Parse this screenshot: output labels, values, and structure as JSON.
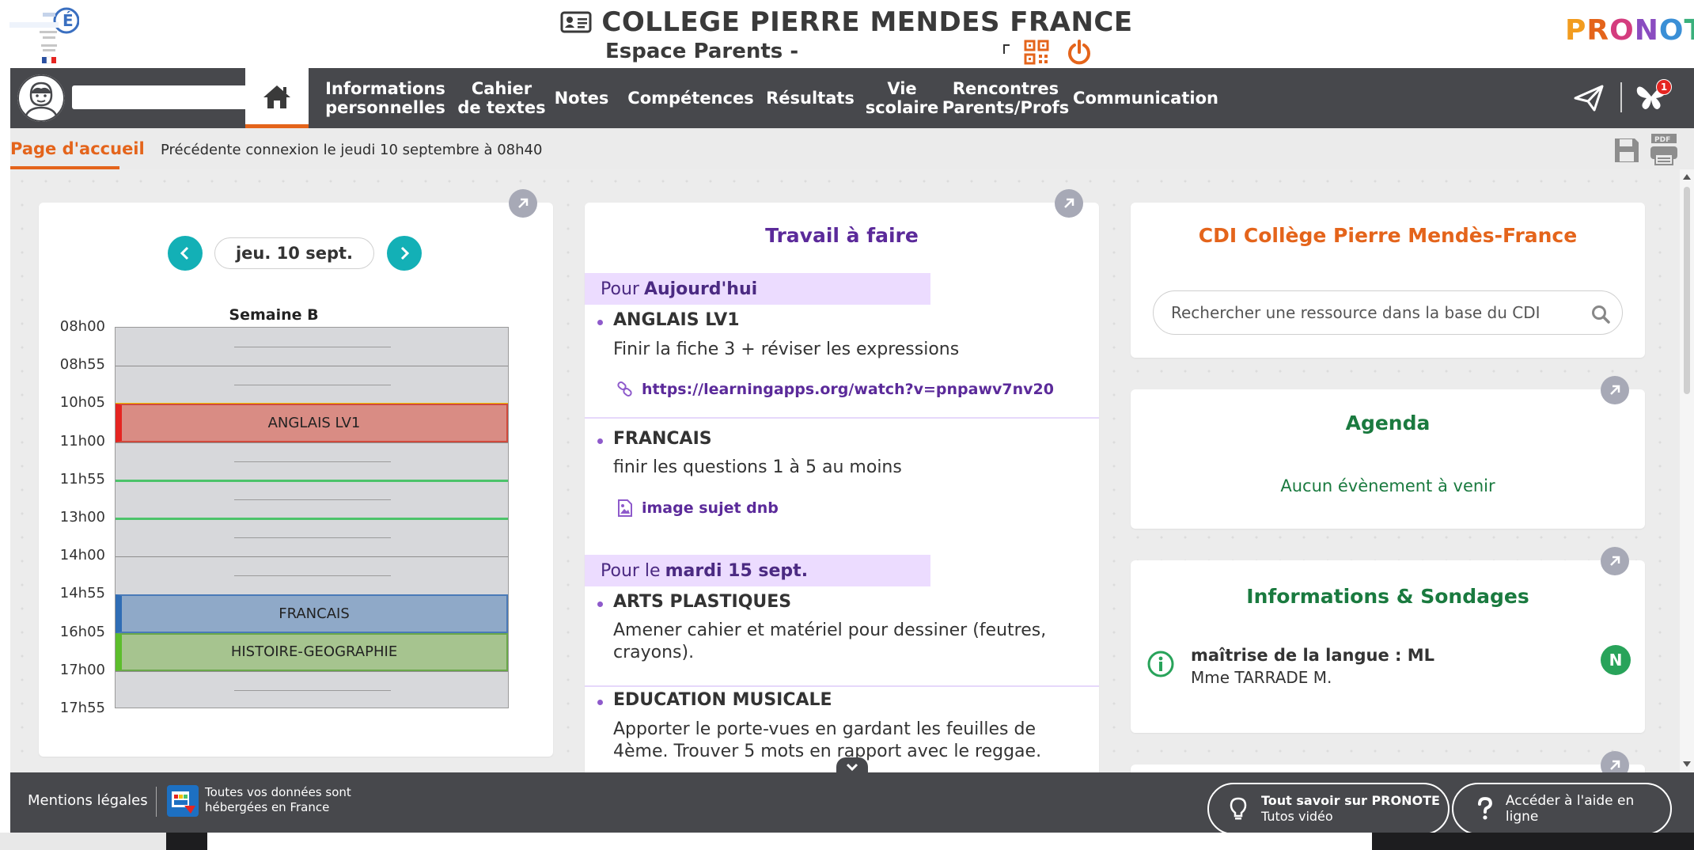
{
  "header": {
    "school_title": "COLLEGE PIERRE MENDES FRANCE",
    "space_label": "Espace Parents -",
    "app_logo": "PRONOTE",
    "colors": {
      "accent": "#e4641b",
      "nav_bg": "#47484c",
      "teal": "#13b0b6",
      "purple": "#5b2a9a",
      "green": "#1a7a3f"
    }
  },
  "nav": {
    "items": [
      {
        "id": "infos",
        "label": "Informations\npersonnelles"
      },
      {
        "id": "cahier",
        "label": "Cahier\nde textes"
      },
      {
        "id": "notes",
        "label": "Notes"
      },
      {
        "id": "competences",
        "label": "Compétences"
      },
      {
        "id": "resultats",
        "label": "Résultats"
      },
      {
        "id": "vie",
        "label": "Vie\nscolaire"
      },
      {
        "id": "rencontres",
        "label": "Rencontres\nParents/Profs"
      },
      {
        "id": "communication",
        "label": "Communication"
      }
    ],
    "notification_count": "1"
  },
  "subbar": {
    "tab_label": "Page d'accueil",
    "last_login": "Précédente connexion le jeudi 10 septembre à 08h40"
  },
  "timetable": {
    "date": "jeu. 10 sept.",
    "week": "Semaine B",
    "times": [
      "08h00",
      "08h55",
      "10h05",
      "11h00",
      "11h55",
      "13h00",
      "14h00",
      "14h55",
      "16h05",
      "17h00",
      "17h55"
    ],
    "courses": [
      {
        "name": "ANGLAIS LV1",
        "start": 2,
        "end": 3,
        "fill": "#d98c84",
        "edge": "#e52521",
        "border": "#d04a3d"
      },
      {
        "name": "FRANCAIS",
        "start": 7,
        "end": 8,
        "fill": "#8fa9c8",
        "edge": "#2f6db5",
        "border": "#4a7ab8"
      },
      {
        "name": "HISTOIRE-GEOGRAPHIE",
        "start": 8,
        "end": 9,
        "fill": "#a6c48f",
        "edge": "#5cbd2c",
        "border": "#6aa84a"
      }
    ],
    "markers": [
      {
        "slot": 4,
        "color": "#4cc36a"
      },
      {
        "slot": 5,
        "color": "#4cc36a"
      },
      {
        "slot": 2,
        "color": "#f2c200"
      }
    ]
  },
  "homework": {
    "title": "Travail à faire",
    "groups": [
      {
        "prefix": "Pour",
        "day": "Aujourd'hui",
        "items": [
          {
            "subject": "ANGLAIS LV1",
            "text": "Finir la fiche 3 + réviser les expressions",
            "link": "https://learningapps.org/watch?v=pnpawv7nv20",
            "link_icon": "link-icon"
          },
          {
            "subject": "FRANCAIS",
            "text": "finir les questions 1 à 5 au moins",
            "link": "image sujet dnb",
            "link_icon": "image-file-icon"
          }
        ]
      },
      {
        "prefix": "Pour le",
        "day": "mardi 15 sept.",
        "items": [
          {
            "subject": "ARTS PLASTIQUES",
            "text": "Amener cahier et matériel pour dessiner (feutres, crayons)."
          },
          {
            "subject": "EDUCATION MUSICALE",
            "text": "Apporter le porte-vues en gardant les feuilles de 4ème. Trouver 5 mots en rapport avec le reggae."
          }
        ]
      }
    ]
  },
  "cdi": {
    "title": "CDI Collège Pierre Mendès-France",
    "search_placeholder": "Rechercher une ressource dans la base du CDI"
  },
  "agenda": {
    "title": "Agenda",
    "empty": "Aucun évènement à venir"
  },
  "info": {
    "title": "Informations & Sondages",
    "subject": "maîtrise de la langue : ML",
    "author": "Mme TARRADE M.",
    "badge": "N"
  },
  "footer": {
    "legal": "Mentions légales",
    "hosting_line1": "Toutes vos données sont",
    "hosting_line2": "hébergées en France",
    "tutos_title": "Tout savoir sur PRONOTE",
    "tutos_sub": "Tutos vidéo",
    "help_label": "Accéder à l'aide en ligne"
  }
}
